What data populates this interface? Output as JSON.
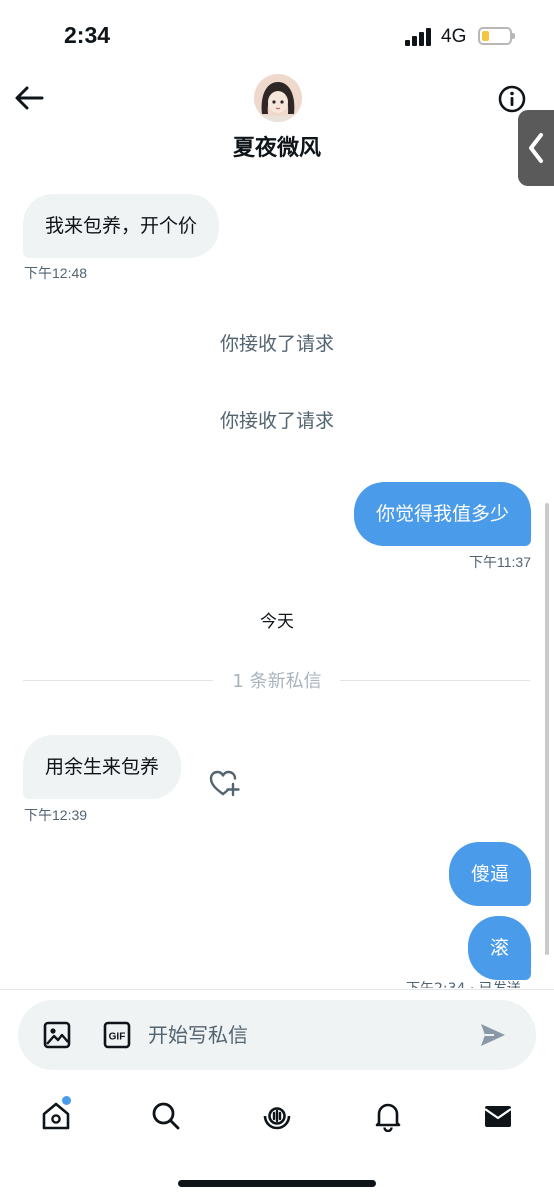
{
  "status_bar": {
    "time": "2:34",
    "network": "4G",
    "battery_level": 0.25
  },
  "header": {
    "title": "夏夜微风"
  },
  "messages": [
    {
      "direction": "incoming",
      "text": "我来包养，开个价",
      "time": "下午12:48"
    },
    {
      "direction": "outgoing",
      "text": "你觉得我值多少",
      "time": "下午11:37"
    },
    {
      "direction": "incoming",
      "text": "用余生来包养",
      "time": "下午12:39"
    },
    {
      "direction": "outgoing",
      "text": "傻逼"
    },
    {
      "direction": "outgoing",
      "text": "滚"
    }
  ],
  "system_messages": [
    "你接收了请求",
    "你接收了请求"
  ],
  "day_separator": "今天",
  "new_messages_divider": "1 条新私信",
  "composer": {
    "placeholder": "开始写私信"
  },
  "icons": {
    "back": "arrow-left-icon",
    "info": "info-icon",
    "side_tab": "chevron-left-icon",
    "like": "heart-plus-icon",
    "image": "image-icon",
    "gif": "gif-icon",
    "send": "send-icon",
    "home": "home-icon",
    "search": "search-icon",
    "spaces": "microphone-icon",
    "notifications": "bell-icon",
    "messages": "envelope-icon"
  },
  "colors": {
    "accent": "#4a9be9",
    "incoming_bubble": "#eff3f4",
    "text": "#0f1419",
    "muted": "#536471"
  }
}
